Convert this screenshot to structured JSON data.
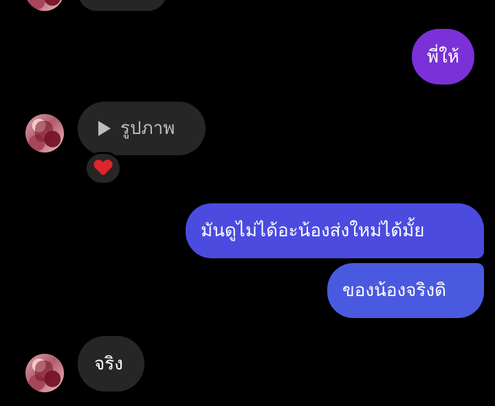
{
  "conversation": {
    "colors": {
      "background": "#000000",
      "incoming_bubble": "#262626",
      "outgoing_purple": "#7a31d8",
      "outgoing_indigo": "#4b4be0",
      "outgoing_blue": "#4a5ae0",
      "reaction_heart": "#e0242c"
    },
    "messages": [
      {
        "sender": "other",
        "text": ""
      },
      {
        "sender": "me",
        "text": "พี่ให้"
      },
      {
        "sender": "other",
        "type": "media",
        "icon": "play-icon",
        "text": "รูปภาพ",
        "reaction": "heart-icon"
      },
      {
        "sender": "me",
        "text": "มันดูไม่ได้อะน้องส่งใหม่ได้มั้ย"
      },
      {
        "sender": "me",
        "text": "ของน้องจริงดิ"
      },
      {
        "sender": "other",
        "text": "จริง"
      }
    ]
  }
}
